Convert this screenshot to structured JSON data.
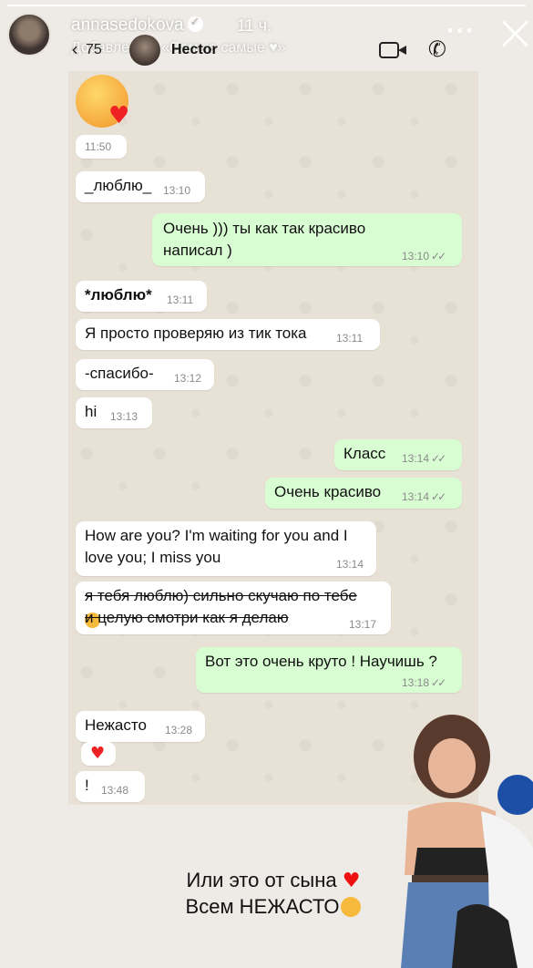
{
  "story": {
    "progress": 1.0,
    "username": "annasedokova",
    "time_ago": "11 ч.",
    "subtitle": "Добавлено в «Самые самые ♥»",
    "more_icon": "more-dots-icon",
    "close_icon": "close-icon"
  },
  "whatsapp": {
    "back_count": "75",
    "contact_name": "Hector",
    "video_icon": "video-call-icon",
    "phone_icon": "phone-call-icon"
  },
  "messages": [
    {
      "dir": "in",
      "emoji": "kiss-emoji",
      "text": "",
      "time": "11:50"
    },
    {
      "dir": "in",
      "text": "_люблю_",
      "time": "13:10"
    },
    {
      "dir": "out",
      "text": "Очень ))) ты как так красиво\nнаписал )",
      "time": "13:10"
    },
    {
      "dir": "in",
      "text": "*люблю*",
      "time": "13:11"
    },
    {
      "dir": "in",
      "text": "Я просто проверяю из тик тока",
      "time": "13:11"
    },
    {
      "dir": "in",
      "text": "-спасибо-",
      "time": "13:12"
    },
    {
      "dir": "in",
      "text": "hi",
      "time": "13:13"
    },
    {
      "dir": "out",
      "text": "Класс",
      "time": "13:14"
    },
    {
      "dir": "out",
      "text": "Очень красиво",
      "time": "13:14"
    },
    {
      "dir": "in",
      "text": "How are you? I'm waiting for you and I\nlove you; I miss you",
      "time": "13:14"
    },
    {
      "dir": "in",
      "strike": true,
      "text": "я тебя люблю) сильно скучаю по тебе\nи целую  смотри как я делаю",
      "time": "13:17"
    },
    {
      "dir": "out",
      "text": "Вот это очень круто ! Научишь ?",
      "time": "13:18"
    },
    {
      "dir": "in",
      "text": "Нежасто",
      "time": "13:28"
    },
    {
      "dir": "in",
      "emoji": "heart-emoji",
      "text": "",
      "time": ""
    },
    {
      "dir": "in",
      "text": "!",
      "time": "13:48"
    }
  ],
  "caption": {
    "line1": "Или это от сына",
    "line2": "Всем НЕЖАСТО"
  },
  "colors": {
    "outgoing": "#d9fdd3",
    "incoming": "#ffffff",
    "background": "#eeebe6",
    "chat_bg": "#e7e1d6"
  }
}
